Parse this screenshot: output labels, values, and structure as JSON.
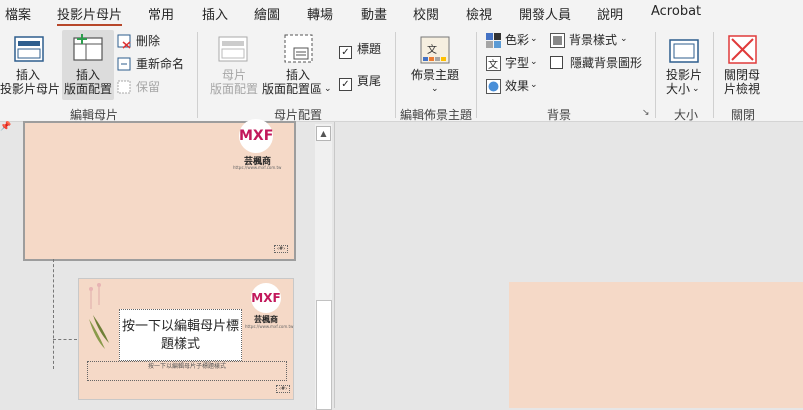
{
  "menu": {
    "items": [
      "檔案",
      "投影片母片",
      "常用",
      "插入",
      "繪圖",
      "轉場",
      "動畫",
      "校閱",
      "檢視",
      "開發人員",
      "說明",
      "Acrobat"
    ]
  },
  "ribbon": {
    "edit_master": {
      "insert_slide_master": [
        "插入",
        "投影片母片"
      ],
      "insert_layout": [
        "插入",
        "版面配置"
      ],
      "delete": "刪除",
      "rename": "重新命名",
      "preserve": "保留",
      "group_label": "編輯母片"
    },
    "master_layout": {
      "master_layout_btn": [
        "母片",
        "版面配置"
      ],
      "insert_placeholder": [
        "插入",
        "版面配置區"
      ],
      "title_check": "標題",
      "footer_check": "頁尾",
      "group_label": "母片配置"
    },
    "edit_theme": {
      "themes": "佈景主題",
      "group_label": "編輯佈景主題"
    },
    "background": {
      "colors": "色彩",
      "fonts": "字型",
      "effects": "效果",
      "background_styles": "背景樣式",
      "hide_background_graphics": "隱藏背景圖形",
      "group_label": "背景"
    },
    "size": {
      "slide_size": [
        "投影片",
        "大小"
      ],
      "group_label": "大小"
    },
    "close": {
      "close_master_view": [
        "關閉母",
        "片檢視"
      ],
      "group_label": "關閉"
    }
  },
  "thumbnails": {
    "logo_text": "MXF",
    "brand_text": "芸楓商",
    "brand_url": "https://www.mxf.com.tw",
    "layout_title": "按一下以編輯母片標題樣式",
    "layout_subtitle": "按一下以編輯母片子標題樣式",
    "slide_number_label": "‹#›"
  },
  "colors": {
    "accent": "#b7472a",
    "slide_bg": "#f5d9c7",
    "close_red": "#e03a3a"
  }
}
